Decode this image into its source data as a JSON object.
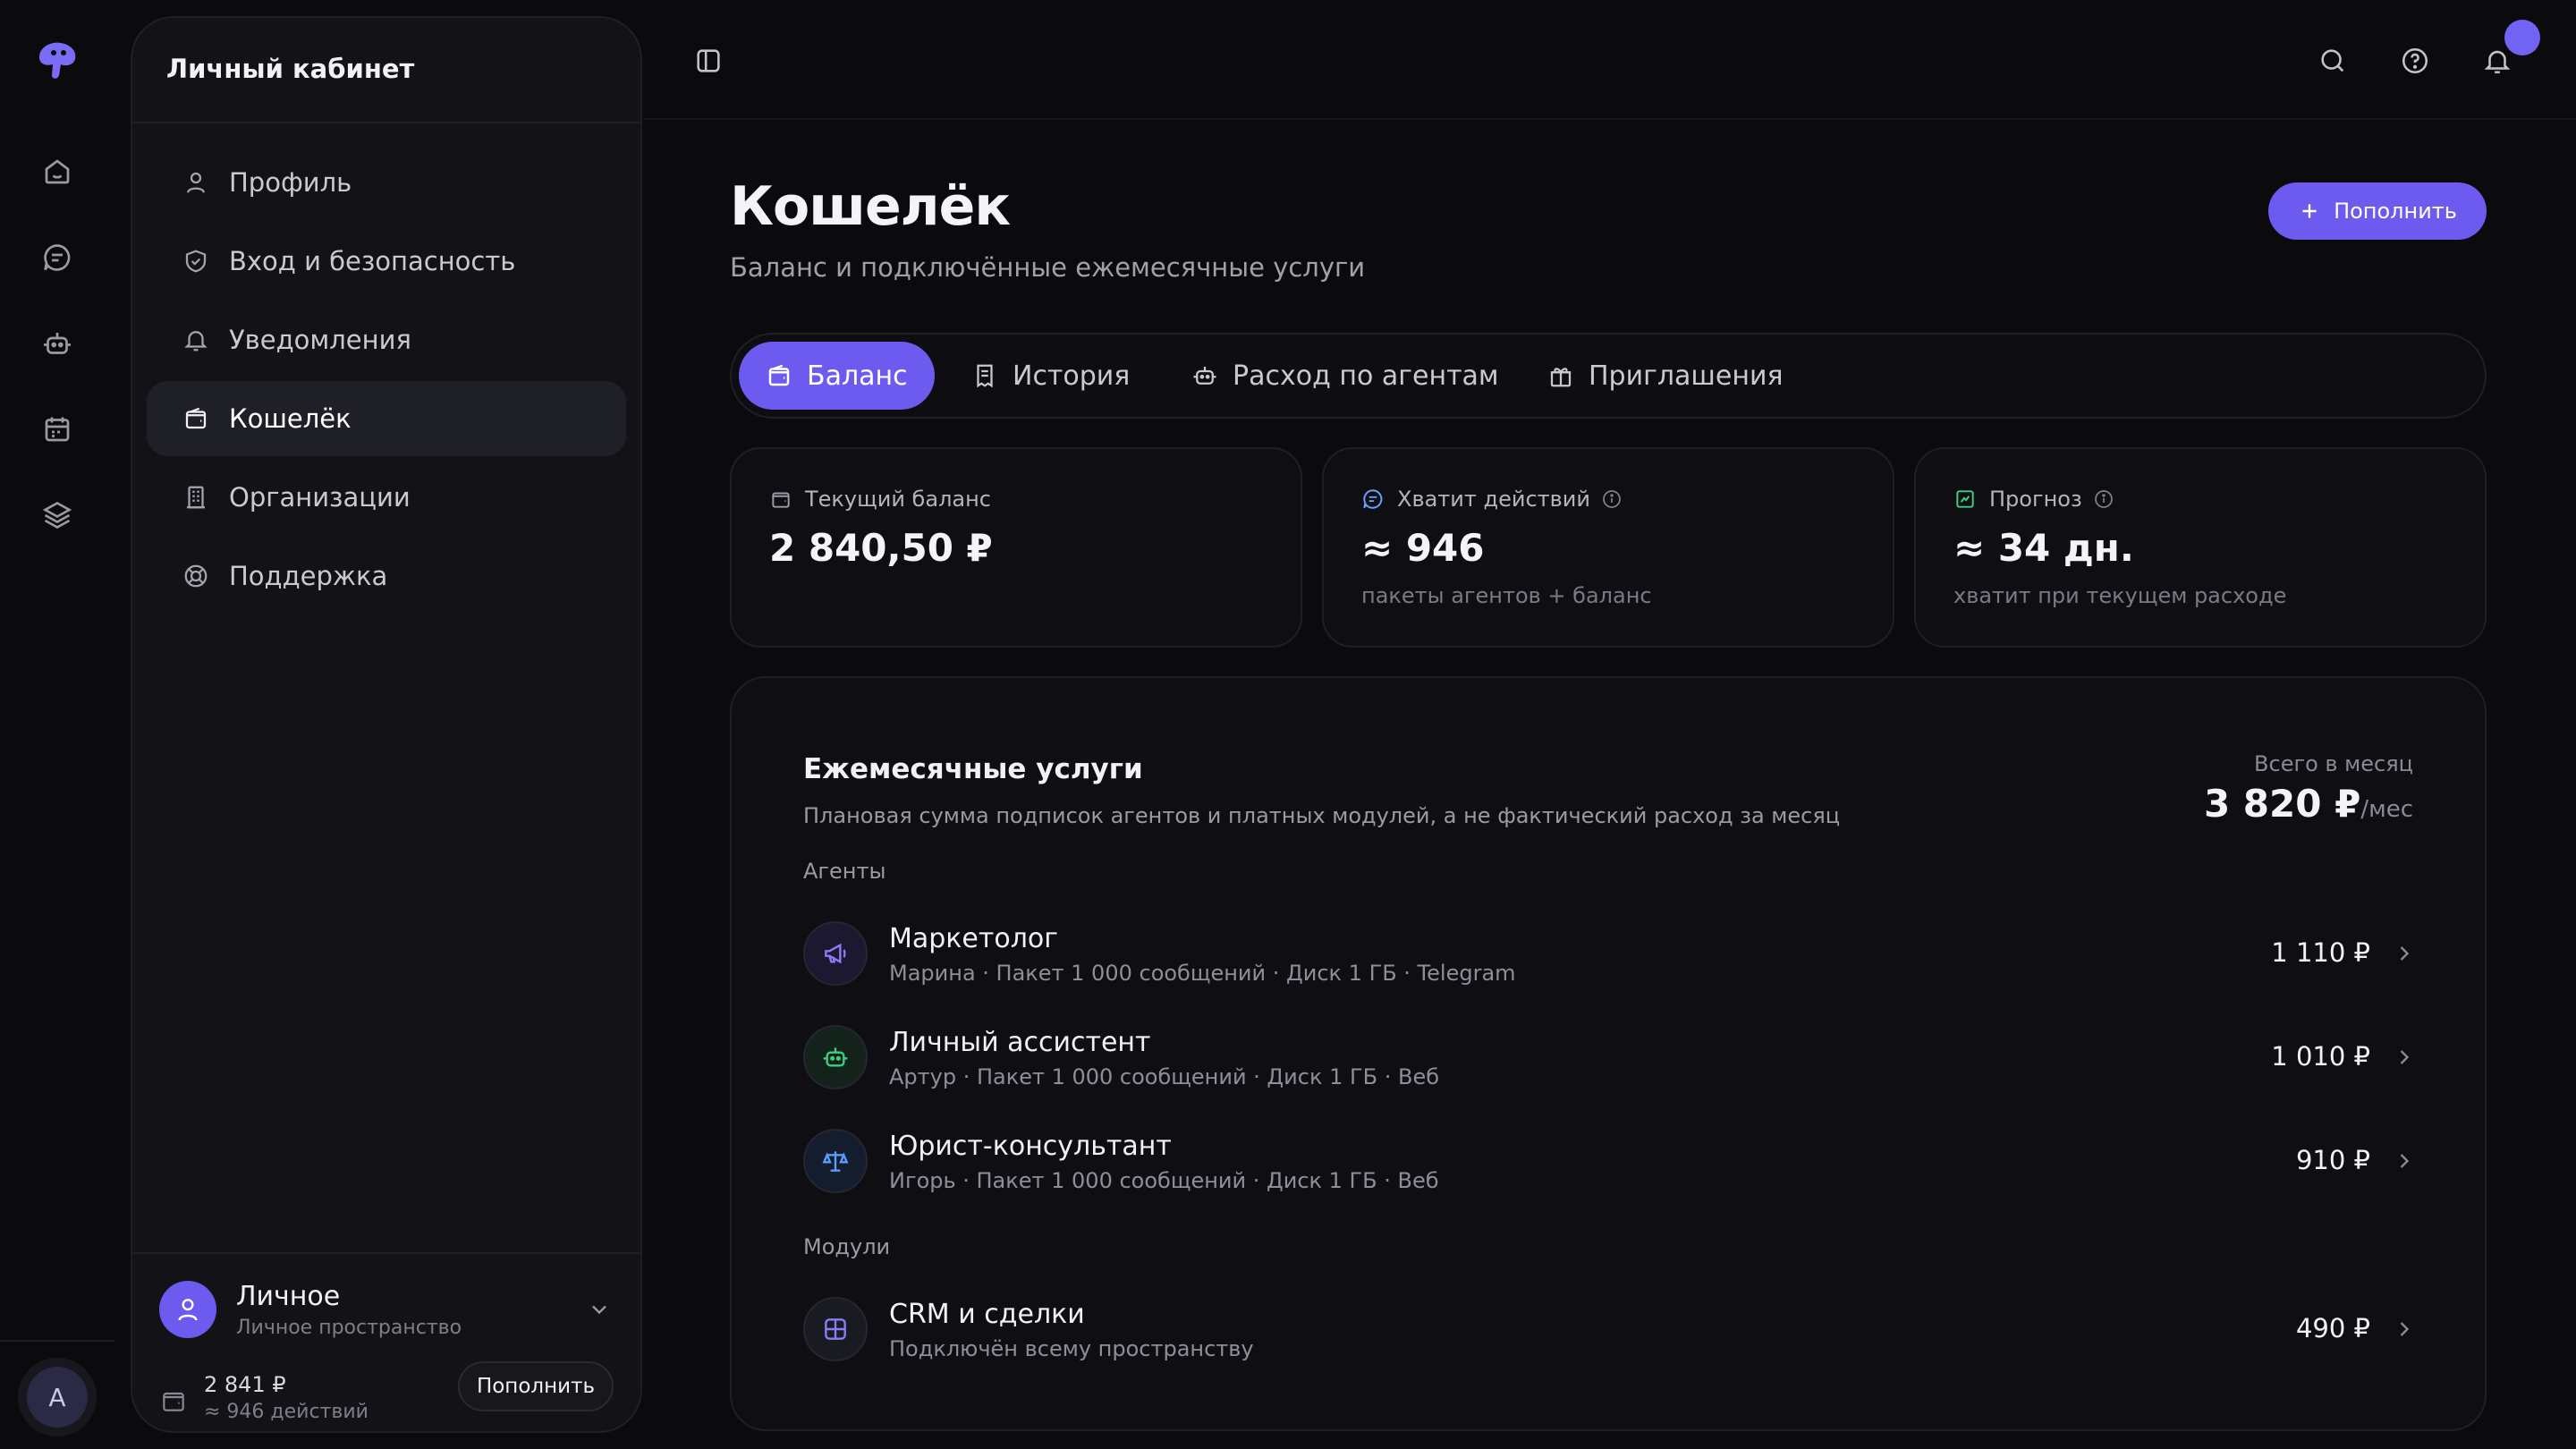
{
  "sidebar": {
    "title": "Личный кабинет",
    "items": [
      {
        "label": "Профиль",
        "icon": "user-icon"
      },
      {
        "label": "Вход и безопасность",
        "icon": "shield-check-icon"
      },
      {
        "label": "Уведомления",
        "icon": "bell-icon"
      },
      {
        "label": "Кошелёк",
        "icon": "wallet-icon",
        "active": true
      },
      {
        "label": "Организации",
        "icon": "building-icon"
      },
      {
        "label": "Поддержка",
        "icon": "lifebuoy-icon"
      }
    ],
    "workspace": {
      "name": "Личное",
      "subtitle": "Личное пространство",
      "balance": "2 841 ₽",
      "actions": "≈ 946 действий",
      "topup_label": "Пополнить"
    }
  },
  "rail": {
    "avatar_letter": "A",
    "icons": [
      "home-icon",
      "chat-icon",
      "robot-icon",
      "calendar-icon",
      "layers-icon"
    ]
  },
  "page": {
    "title": "Кошелёк",
    "subtitle": "Баланс и подключённые ежемесячные услуги",
    "topup_label": "Пополнить"
  },
  "tabs": [
    {
      "label": "Баланс",
      "icon": "wallet-icon",
      "active": true
    },
    {
      "label": "История",
      "icon": "receipt-icon"
    },
    {
      "label": "Расход по агентам",
      "icon": "robot-icon"
    },
    {
      "label": "Приглашения",
      "icon": "gift-icon"
    }
  ],
  "stats": [
    {
      "label": "Текущий баланс",
      "value": "2 840,50 ₽",
      "note": "",
      "icon": "wallet-icon"
    },
    {
      "label": "Хватит действий",
      "value": "≈ 946",
      "note": "пакеты агентов + баланс",
      "icon": "chat-icon",
      "icon_color": "#6aa0ff"
    },
    {
      "label": "Прогноз",
      "value": "≈ 34 дн.",
      "note": "хватит при текущем расходе",
      "icon": "chart-icon",
      "icon_color": "#3ccf83"
    }
  ],
  "services": {
    "title": "Ежемесячные услуги",
    "subtitle": "Плановая сумма подписок агентов и платных модулей, а не фактический расход за месяц",
    "total_label": "Всего в месяц",
    "total_value": "3 820 ₽",
    "total_unit": "/мес",
    "agents_label": "Агенты",
    "modules_label": "Модули",
    "agents": [
      {
        "name": "Маркетолог",
        "meta": "Марина · Пакет 1 000 сообщений · Диск 1 ГБ · Telegram",
        "price": "1 110 ₽",
        "icon": "megaphone-icon",
        "color": "#8b7cf6"
      },
      {
        "name": "Личный ассистент",
        "meta": "Артур · Пакет 1 000 сообщений · Диск 1 ГБ · Веб",
        "price": "1 010 ₽",
        "icon": "robot-icon",
        "color": "#3ccf83"
      },
      {
        "name": "Юрист-консультант",
        "meta": "Игорь · Пакет 1 000 сообщений · Диск 1 ГБ · Веб",
        "price": "910 ₽",
        "icon": "scales-icon",
        "color": "#5b9cff"
      }
    ],
    "modules": [
      {
        "name": "CRM и сделки",
        "meta": "Подключён всему пространству",
        "price": "490 ₽",
        "icon": "grid-icon",
        "color": "#8b7cf6"
      }
    ]
  },
  "colors": {
    "accent": "#6d5bf0",
    "background": "#0b0b0e",
    "card": "#0f0f13"
  }
}
